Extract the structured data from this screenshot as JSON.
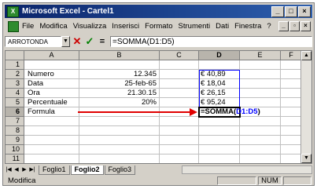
{
  "window": {
    "title": "Microsoft Excel - Cartel1"
  },
  "menu": [
    "File",
    "Modifica",
    "Visualizza",
    "Inserisci",
    "Formato",
    "Strumenti",
    "Dati",
    "Finestra",
    "?"
  ],
  "formula_bar": {
    "name_box": "ARROTONDA",
    "formula": "=SOMMA(D1:D5)"
  },
  "columns": [
    "A",
    "B",
    "C",
    "D",
    "E",
    "F"
  ],
  "rows": [
    "1",
    "2",
    "3",
    "4",
    "5",
    "6",
    "7",
    "8",
    "9",
    "10",
    "11"
  ],
  "cells": {
    "a2": "Numero",
    "b2": "12.345",
    "d2": "€   40,89",
    "a3": "Data",
    "b3": "25-feb-65",
    "d3": "€   18,04",
    "a4": "Ora",
    "b4": "21.30.15",
    "d4": "€   26,15",
    "a5": "Percentuale",
    "b5": "20%",
    "d5": "€   95,24",
    "a6": "Formula",
    "d6_fn": "=SOMMA(",
    "d6_ref": "D1:D5",
    "d6_close": ")"
  },
  "sheet_tabs": [
    "Foglio1",
    "Foglio2",
    "Foglio3"
  ],
  "active_tab": "Foglio2",
  "status": {
    "mode": "Modifica",
    "num": "NUM"
  },
  "colors": {
    "title_bar": "#0a246a",
    "arrow": "#e00000",
    "reference": "#0000ff"
  }
}
